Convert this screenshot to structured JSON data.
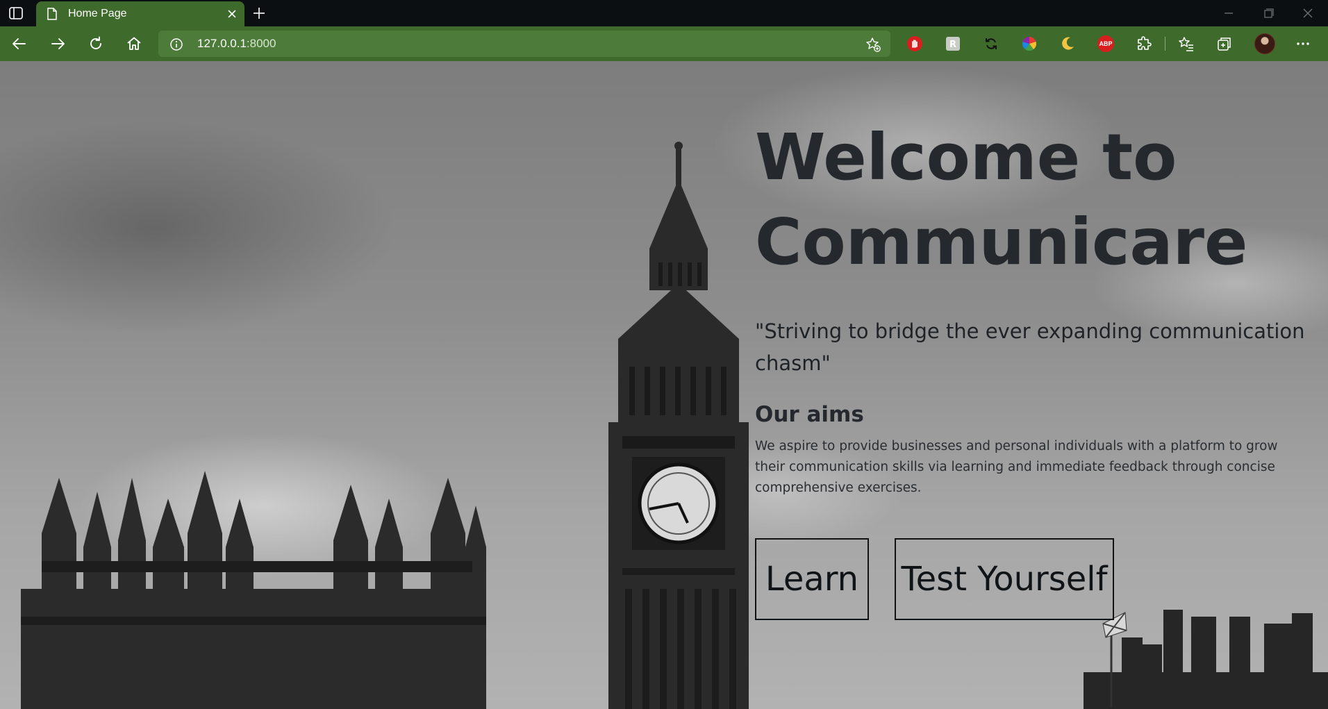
{
  "browser": {
    "tab_title": "Home Page",
    "url_host": "127.0.0.1",
    "url_rest": ":8000",
    "icons": {
      "tab_actions": "tab-actions-icon",
      "tab_page": "page-icon",
      "tab_close": "close-icon",
      "new_tab": "plus-icon",
      "back": "back-arrow-icon",
      "forward": "forward-arrow-icon",
      "refresh": "refresh-icon",
      "home": "home-icon",
      "site_info": "info-icon",
      "add_favorite": "star-add-icon",
      "extensions": "puzzle-icon",
      "favorites": "favorites-icon",
      "collections": "collections-icon",
      "menu": "more-icon"
    },
    "extension_abp_label": "ABP",
    "colors": {
      "accent": "#3e6b2c",
      "address_bar": "#4d7c3a",
      "tabbar": "#0b0f12"
    }
  },
  "page": {
    "headline_line1": "Welcome to",
    "headline_line2": "Communicare",
    "tagline": "\"Striving to bridge the ever expanding communication chasm\"",
    "aims_title": "Our aims",
    "aims_text": "We aspire to provide businesses and personal individuals with a platform to grow their communication skills via learning and immediate feedback through concise comprehensive exercises.",
    "learn_button": "Learn",
    "test_button": "Test Yourself",
    "background": "grayscale photo of Big Ben and the Palace of Westminster"
  }
}
